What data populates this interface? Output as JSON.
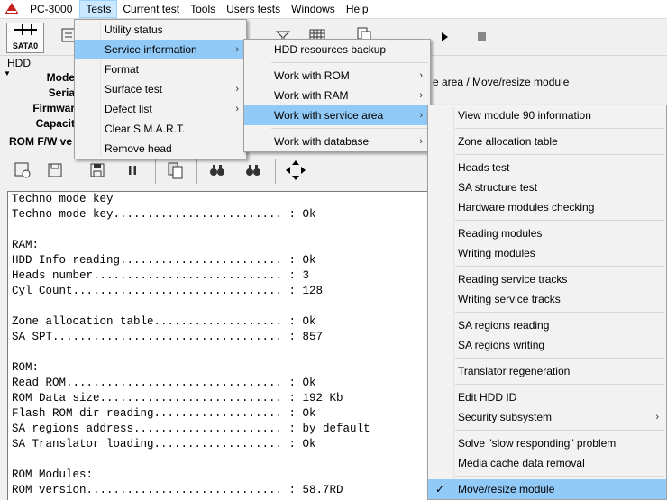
{
  "menubar": {
    "app_title": "PC-3000",
    "items": [
      "Tests",
      "Current test",
      "Tools",
      "Users tests",
      "Windows",
      "Help"
    ]
  },
  "toolbar": {
    "sata_label": "SATA0"
  },
  "hdd": {
    "caption": "HDD",
    "labels": [
      "Mode",
      "Seria",
      "Firmwar",
      "Capacit"
    ],
    "path": "e area / Move/resize module"
  },
  "rom_panel": {
    "title": "ROM F/W ve"
  },
  "log": [
    "Techno mode key",
    "Techno mode key......................... : Ok",
    "",
    "RAM:",
    "HDD Info reading........................ : Ok",
    "Heads number............................ : 3",
    "Cyl Count............................... : 128",
    "",
    "Zone allocation table................... : Ok",
    "SA SPT.................................. : 857",
    "",
    "ROM:",
    "Read ROM................................ : Ok",
    "ROM Data size........................... : 192 Kb",
    "Flash ROM dir reading................... : Ok",
    "SA regions address...................... : by default",
    "SA Translator loading................... : Ok",
    "",
    "ROM Modules:",
    "ROM version............................. : 58.7RD"
  ],
  "tests_menu": [
    {
      "label": "Utility status"
    },
    {
      "label": "Service information",
      "arrow": "›",
      "highlight": true
    },
    {
      "label": "Format"
    },
    {
      "label": "Surface test",
      "arrow": "›"
    },
    {
      "label": "Defect list",
      "arrow": "›"
    },
    {
      "label": "Clear S.M.A.R.T."
    },
    {
      "label": "Remove head"
    }
  ],
  "service_info_menu": [
    {
      "label": "HDD resources backup"
    },
    {
      "sep": true
    },
    {
      "label": "Work with ROM",
      "arrow": "›"
    },
    {
      "label": "Work with RAM",
      "arrow": "›"
    },
    {
      "label": "Work with service area",
      "arrow": "›",
      "highlight": true
    },
    {
      "sep": true
    },
    {
      "label": "Work with database",
      "arrow": "›"
    }
  ],
  "service_area_menu": [
    {
      "label": "View module 90 information"
    },
    {
      "sep": true
    },
    {
      "label": "Zone allocation table"
    },
    {
      "sep": true
    },
    {
      "label": "Heads test"
    },
    {
      "label": "SA structure test"
    },
    {
      "label": "Hardware modules checking"
    },
    {
      "sep": true
    },
    {
      "label": "Reading modules"
    },
    {
      "label": "Writing modules"
    },
    {
      "sep": true
    },
    {
      "label": "Reading service tracks"
    },
    {
      "label": "Writing service tracks"
    },
    {
      "sep": true
    },
    {
      "label": "SA regions reading"
    },
    {
      "label": "SA regions writing"
    },
    {
      "sep": true
    },
    {
      "label": "Translator regeneration"
    },
    {
      "sep": true
    },
    {
      "label": "Edit HDD ID"
    },
    {
      "label": "Security subsystem",
      "arrow": "›"
    },
    {
      "sep": true
    },
    {
      "label": "Solve \"slow responding\" problem"
    },
    {
      "label": "Media cache data removal"
    },
    {
      "sep": true
    },
    {
      "label": "Move/resize module",
      "highlight": true,
      "checked": true,
      "check_mark": "✓"
    }
  ]
}
